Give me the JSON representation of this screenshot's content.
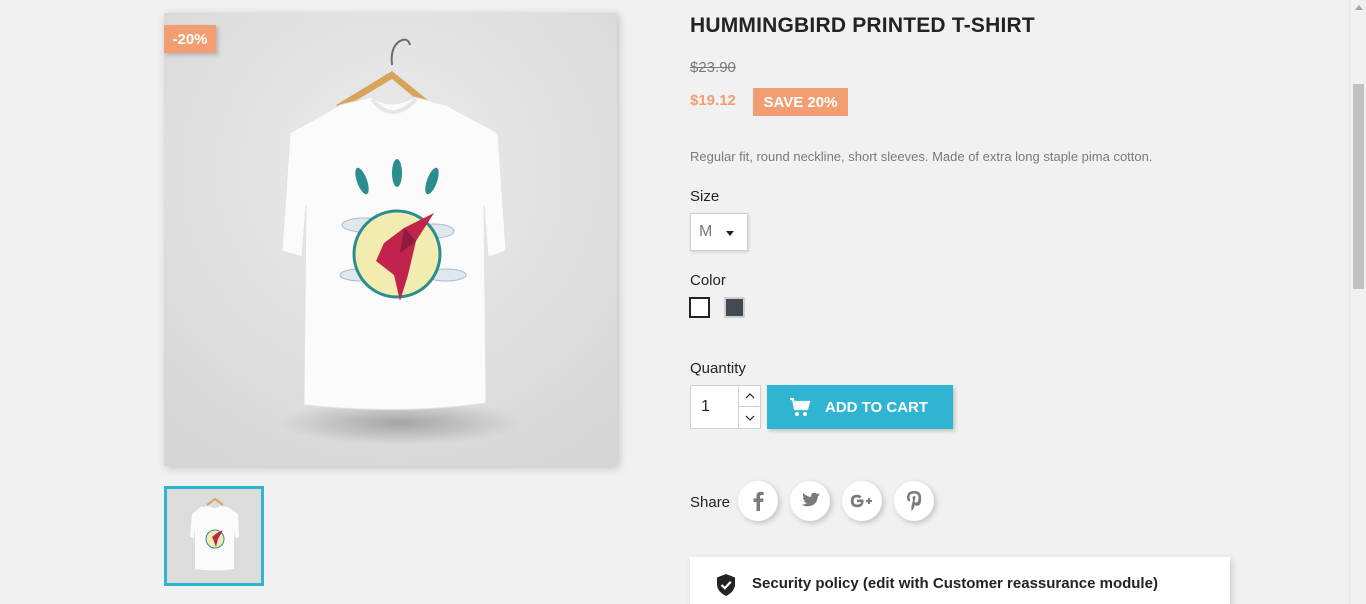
{
  "product": {
    "title": "HUMMINGBIRD PRINTED T-SHIRT",
    "discount_flag": "-20%",
    "regular_price": "$23.90",
    "current_price": "$19.12",
    "save_badge": "SAVE 20%",
    "description": "Regular fit, round neckline, short sleeves. Made of extra long staple pima cotton."
  },
  "variants": {
    "size_label": "Size",
    "size_selected": "M",
    "color_label": "Color",
    "colors": [
      {
        "name": "White",
        "hex": "#ffffff"
      },
      {
        "name": "Grey",
        "hex": "#434a54"
      }
    ]
  },
  "cart": {
    "quantity_label": "Quantity",
    "quantity_value": "1",
    "add_to_cart_label": "ADD TO CART"
  },
  "share": {
    "label": "Share",
    "networks": [
      "facebook",
      "twitter",
      "google-plus",
      "pinterest"
    ]
  },
  "reassurance": {
    "text": "Security policy (edit with Customer reassurance module)"
  },
  "colors": {
    "accent": "#2fb5d2",
    "discount": "#f39d72",
    "text": "#232323",
    "muted": "#7a7a7a"
  }
}
